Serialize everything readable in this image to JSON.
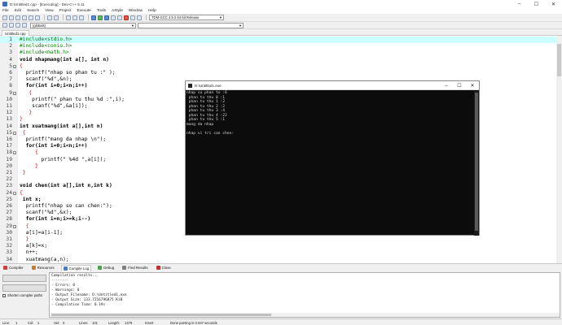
{
  "window": {
    "title": "D:\\Untitled1.cpp - [Executing] - Dev-C++ 5.11"
  },
  "menu": [
    "File",
    "Edit",
    "Search",
    "View",
    "Project",
    "Execute",
    "Tools",
    "AStyle",
    "Window",
    "Help"
  ],
  "toolbar": {
    "compiler_select": "TDM-GCC 4.9.2 64-bit Release",
    "scope_select": "(globals)"
  },
  "editor": {
    "tab": "Untitled1.cpp",
    "lines": [
      {
        "n": "1",
        "fold": "",
        "text": "#include<stdio.h>",
        "kind": "pp"
      },
      {
        "n": "2",
        "fold": "",
        "text": "#include<conio.h>",
        "kind": "pp"
      },
      {
        "n": "3",
        "fold": "",
        "text": "#include<math.h>",
        "kind": "pp"
      },
      {
        "n": "4",
        "fold": "",
        "text": "void nhapmang(int a[], int n)",
        "kind": "kw"
      },
      {
        "n": "5",
        "fold": "-",
        "text": "{",
        "kind": "sym"
      },
      {
        "n": "6",
        "fold": "",
        "text": "  printf(\"nhap so phan tu :\" );",
        "kind": "str"
      },
      {
        "n": "7",
        "fold": "",
        "text": "  scanf(\"%d\",&n);",
        "kind": "str"
      },
      {
        "n": "8",
        "fold": "",
        "text": "  for(int i=0;i<n;i++)",
        "kind": "kw"
      },
      {
        "n": "9",
        "fold": "-",
        "text": "   {",
        "kind": "sym"
      },
      {
        "n": "10",
        "fold": "",
        "text": "    printf(\" phan tu thu %d :\",i);",
        "kind": "str"
      },
      {
        "n": "11",
        "fold": "",
        "text": "    scanf(\"%d\",&a[i]);",
        "kind": "str"
      },
      {
        "n": "12",
        "fold": "",
        "text": "   }",
        "kind": "sym"
      },
      {
        "n": "13",
        "fold": "",
        "text": "}",
        "kind": "sym"
      },
      {
        "n": "14",
        "fold": "",
        "text": "int xuatmang(int a[],int n)",
        "kind": "kw"
      },
      {
        "n": "15",
        "fold": "-",
        "text": " {",
        "kind": "sym"
      },
      {
        "n": "16",
        "fold": "",
        "text": "  printf(\"mang da nhap \\n\");",
        "kind": "str"
      },
      {
        "n": "17",
        "fold": "",
        "text": "  for(int i=0;i<n;i++)",
        "kind": "kw"
      },
      {
        "n": "18",
        "fold": "-",
        "text": "     {",
        "kind": "sym"
      },
      {
        "n": "19",
        "fold": "",
        "text": "       printf(\" %4d \",a[i]);",
        "kind": "str"
      },
      {
        "n": "20",
        "fold": "",
        "text": "     }",
        "kind": "sym"
      },
      {
        "n": "21",
        "fold": "",
        "text": " }",
        "kind": "sym"
      },
      {
        "n": "22",
        "fold": "",
        "text": "",
        "kind": "plain"
      },
      {
        "n": "23",
        "fold": "",
        "text": "void chen(int a[],int n,int k)",
        "kind": "kw"
      },
      {
        "n": "24",
        "fold": "-",
        "text": "{",
        "kind": "sym"
      },
      {
        "n": "25",
        "fold": "",
        "text": " int x;",
        "kind": "kw"
      },
      {
        "n": "26",
        "fold": "",
        "text": "  printf(\"nhap so can chen:\");",
        "kind": "str"
      },
      {
        "n": "27",
        "fold": "",
        "text": "  scanf(\"%d\",&x);",
        "kind": "str"
      },
      {
        "n": "28",
        "fold": "",
        "text": "  for(int i=n;i>=k;i--)",
        "kind": "kw"
      },
      {
        "n": "29",
        "fold": "-",
        "text": "  {",
        "kind": "sym"
      },
      {
        "n": "30",
        "fold": "",
        "text": "  a[i]=a[i-1];",
        "kind": "plain"
      },
      {
        "n": "31",
        "fold": "",
        "text": "  }",
        "kind": "sym"
      },
      {
        "n": "32",
        "fold": "",
        "text": "  a[k]=x;",
        "kind": "plain"
      },
      {
        "n": "33",
        "fold": "",
        "text": "  n++;",
        "kind": "plain"
      },
      {
        "n": "34",
        "fold": "",
        "text": "  xuatmang(a,n);",
        "kind": "plain"
      }
    ]
  },
  "console": {
    "title": "D:\\Untitled1.exe",
    "lines": [
      "nhap so phan tu :6",
      " phan tu thu 0 :1",
      " phan tu thu 1 :2",
      " phan tu thu 2 :2",
      " phan tu thu 3 :4",
      " phan tu thu 4 :22",
      " phan tu thu 5 :1",
      "mang da nhap",
      "",
      "nhap vi tri can chen:"
    ]
  },
  "bottom_tabs": [
    "Compiler",
    "Resources",
    "Compile Log",
    "Debug",
    "Find Results",
    "Close"
  ],
  "compile_log": {
    "shorten_label": "Shorten compiler paths",
    "lines": [
      "Compilation results...",
      "--------",
      "- Errors: 0",
      "- Warnings: 0",
      "- Output Filename: D:\\Untitled1.exe",
      "- Output Size: 133.7216796875 KiB",
      "- Compilation Time: 0.19s"
    ]
  },
  "status": {
    "line_label": "Line:",
    "line_value": "1",
    "col_label": "Col:",
    "col_value": "1",
    "sel_label": "Sel:",
    "sel_value": "0",
    "lines_label": "Lines:",
    "lines_value": "101",
    "length_label": "Length:",
    "length_value": "1479",
    "mode": "Insert",
    "message": "Done parsing in 0.047 seconds"
  }
}
